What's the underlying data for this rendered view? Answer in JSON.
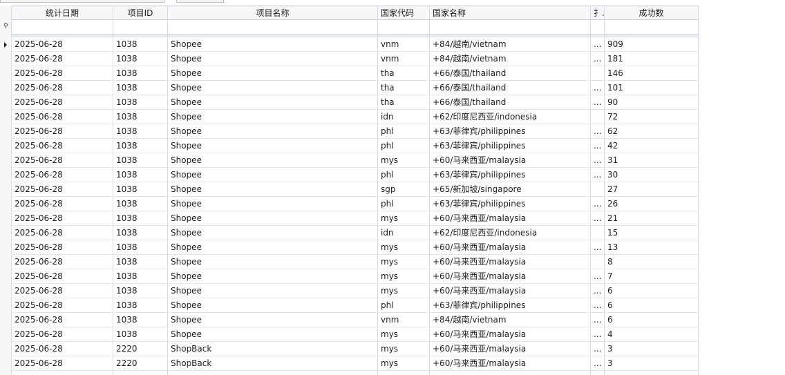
{
  "columns": [
    {
      "key": "date",
      "label": "统计日期"
    },
    {
      "key": "pid",
      "label": "项目ID"
    },
    {
      "key": "pname",
      "label": "项目名称"
    },
    {
      "key": "ccode",
      "label": "国家代码"
    },
    {
      "key": "cname",
      "label": "国家名称"
    },
    {
      "key": "extra",
      "label": "扌.."
    },
    {
      "key": "count",
      "label": "成功数"
    }
  ],
  "rows": [
    {
      "date": "2025-06-28",
      "pid": "1038",
      "pname": "Shopee",
      "ccode": "vnm",
      "cname": "+84/越南/vietnam",
      "extra": "...",
      "count": "909"
    },
    {
      "date": "2025-06-28",
      "pid": "1038",
      "pname": "Shopee",
      "ccode": "vnm",
      "cname": "+84/越南/vietnam",
      "extra": "...",
      "count": "181"
    },
    {
      "date": "2025-06-28",
      "pid": "1038",
      "pname": "Shopee",
      "ccode": "tha",
      "cname": "+66/泰国/thailand",
      "extra": "",
      "count": "146"
    },
    {
      "date": "2025-06-28",
      "pid": "1038",
      "pname": "Shopee",
      "ccode": "tha",
      "cname": "+66/泰国/thailand",
      "extra": "...",
      "count": "101"
    },
    {
      "date": "2025-06-28",
      "pid": "1038",
      "pname": "Shopee",
      "ccode": "tha",
      "cname": "+66/泰国/thailand",
      "extra": "...",
      "count": "90"
    },
    {
      "date": "2025-06-28",
      "pid": "1038",
      "pname": "Shopee",
      "ccode": "idn",
      "cname": "+62/印度尼西亚/indonesia",
      "extra": "",
      "count": "72"
    },
    {
      "date": "2025-06-28",
      "pid": "1038",
      "pname": "Shopee",
      "ccode": "phl",
      "cname": "+63/菲律宾/philippines",
      "extra": "...",
      "count": "62"
    },
    {
      "date": "2025-06-28",
      "pid": "1038",
      "pname": "Shopee",
      "ccode": "phl",
      "cname": "+63/菲律宾/philippines",
      "extra": "...",
      "count": "42"
    },
    {
      "date": "2025-06-28",
      "pid": "1038",
      "pname": "Shopee",
      "ccode": "mys",
      "cname": "+60/马来西亚/malaysia",
      "extra": "...",
      "count": "31"
    },
    {
      "date": "2025-06-28",
      "pid": "1038",
      "pname": "Shopee",
      "ccode": "phl",
      "cname": "+63/菲律宾/philippines",
      "extra": "...",
      "count": "30"
    },
    {
      "date": "2025-06-28",
      "pid": "1038",
      "pname": "Shopee",
      "ccode": "sgp",
      "cname": "+65/新加坡/singapore",
      "extra": "",
      "count": "27"
    },
    {
      "date": "2025-06-28",
      "pid": "1038",
      "pname": "Shopee",
      "ccode": "phl",
      "cname": "+63/菲律宾/philippines",
      "extra": "...",
      "count": "26"
    },
    {
      "date": "2025-06-28",
      "pid": "1038",
      "pname": "Shopee",
      "ccode": "mys",
      "cname": "+60/马来西亚/malaysia",
      "extra": "...",
      "count": "21"
    },
    {
      "date": "2025-06-28",
      "pid": "1038",
      "pname": "Shopee",
      "ccode": "idn",
      "cname": "+62/印度尼西亚/indonesia",
      "extra": "",
      "count": "15"
    },
    {
      "date": "2025-06-28",
      "pid": "1038",
      "pname": "Shopee",
      "ccode": "mys",
      "cname": "+60/马来西亚/malaysia",
      "extra": "...",
      "count": "13"
    },
    {
      "date": "2025-06-28",
      "pid": "1038",
      "pname": "Shopee",
      "ccode": "mys",
      "cname": "+60/马来西亚/malaysia",
      "extra": "",
      "count": "8"
    },
    {
      "date": "2025-06-28",
      "pid": "1038",
      "pname": "Shopee",
      "ccode": "mys",
      "cname": "+60/马来西亚/malaysia",
      "extra": "...",
      "count": "7"
    },
    {
      "date": "2025-06-28",
      "pid": "1038",
      "pname": "Shopee",
      "ccode": "mys",
      "cname": "+60/马来西亚/malaysia",
      "extra": "...",
      "count": "6"
    },
    {
      "date": "2025-06-28",
      "pid": "1038",
      "pname": "Shopee",
      "ccode": "phl",
      "cname": "+63/菲律宾/philippines",
      "extra": "...",
      "count": "6"
    },
    {
      "date": "2025-06-28",
      "pid": "1038",
      "pname": "Shopee",
      "ccode": "vnm",
      "cname": "+84/越南/vietnam",
      "extra": "...",
      "count": "6"
    },
    {
      "date": "2025-06-28",
      "pid": "1038",
      "pname": "Shopee",
      "ccode": "mys",
      "cname": "+60/马来西亚/malaysia",
      "extra": "...",
      "count": "4"
    },
    {
      "date": "2025-06-28",
      "pid": "2220",
      "pname": "ShopBack",
      "ccode": "mys",
      "cname": "+60/马来西亚/malaysia",
      "extra": "...",
      "count": "3"
    },
    {
      "date": "2025-06-28",
      "pid": "2220",
      "pname": "ShopBack",
      "ccode": "mys",
      "cname": "+60/马来西亚/malaysia",
      "extra": "...",
      "count": "3"
    }
  ]
}
